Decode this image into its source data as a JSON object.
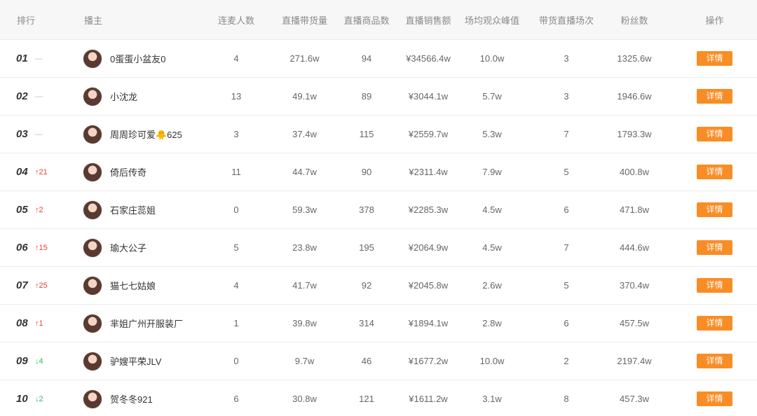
{
  "headers": {
    "rank": "排行",
    "anchor": "播主",
    "lianmai": "连麦人数",
    "gmv": "直播带货量",
    "goods": "直播商品数",
    "sales": "直播销售额",
    "peak": "场均观众峰值",
    "sessions": "带货直播场次",
    "fans": "粉丝数",
    "op": "操作"
  },
  "detail_label": "详情",
  "colors": {
    "accent": "#f98d25",
    "up": "#e8413a",
    "down": "#2fb866"
  },
  "rows": [
    {
      "rank": "01",
      "change": "—",
      "dir": "same",
      "name": "0蛋蛋小盆友0",
      "lianmai": "4",
      "gmv": "271.6w",
      "goods": "94",
      "sales": "¥34566.4w",
      "peak": "10.0w",
      "sessions": "3",
      "fans": "1325.6w"
    },
    {
      "rank": "02",
      "change": "—",
      "dir": "same",
      "name": "小沈龙",
      "lianmai": "13",
      "gmv": "49.1w",
      "goods": "89",
      "sales": "¥3044.1w",
      "peak": "5.7w",
      "sessions": "3",
      "fans": "1946.6w"
    },
    {
      "rank": "03",
      "change": "—",
      "dir": "same",
      "name": "周周珍可爱🐥625",
      "lianmai": "3",
      "gmv": "37.4w",
      "goods": "115",
      "sales": "¥2559.7w",
      "peak": "5.3w",
      "sessions": "7",
      "fans": "1793.3w"
    },
    {
      "rank": "04",
      "change": "↑21",
      "dir": "up",
      "name": "倚后传奇",
      "lianmai": "11",
      "gmv": "44.7w",
      "goods": "90",
      "sales": "¥2311.4w",
      "peak": "7.9w",
      "sessions": "5",
      "fans": "400.8w"
    },
    {
      "rank": "05",
      "change": "↑2",
      "dir": "up",
      "name": "石家庄蕊姐",
      "lianmai": "0",
      "gmv": "59.3w",
      "goods": "378",
      "sales": "¥2285.3w",
      "peak": "4.5w",
      "sessions": "6",
      "fans": "471.8w"
    },
    {
      "rank": "06",
      "change": "↑15",
      "dir": "up",
      "name": "瑜大公子",
      "lianmai": "5",
      "gmv": "23.8w",
      "goods": "195",
      "sales": "¥2064.9w",
      "peak": "4.5w",
      "sessions": "7",
      "fans": "444.6w"
    },
    {
      "rank": "07",
      "change": "↑25",
      "dir": "up",
      "name": "猫七七姑娘",
      "lianmai": "4",
      "gmv": "41.7w",
      "goods": "92",
      "sales": "¥2045.8w",
      "peak": "2.6w",
      "sessions": "5",
      "fans": "370.4w"
    },
    {
      "rank": "08",
      "change": "↑1",
      "dir": "up",
      "name": "芈姐广州开服装厂",
      "lianmai": "1",
      "gmv": "39.8w",
      "goods": "314",
      "sales": "¥1894.1w",
      "peak": "2.8w",
      "sessions": "6",
      "fans": "457.5w"
    },
    {
      "rank": "09",
      "change": "↓4",
      "dir": "down",
      "name": "驴嫂平荣JLV",
      "lianmai": "0",
      "gmv": "9.7w",
      "goods": "46",
      "sales": "¥1677.2w",
      "peak": "10.0w",
      "sessions": "2",
      "fans": "2197.4w"
    },
    {
      "rank": "10",
      "change": "↓2",
      "dir": "down",
      "name": "贺冬冬921",
      "lianmai": "6",
      "gmv": "30.8w",
      "goods": "121",
      "sales": "¥1611.2w",
      "peak": "3.1w",
      "sessions": "8",
      "fans": "457.3w"
    }
  ]
}
